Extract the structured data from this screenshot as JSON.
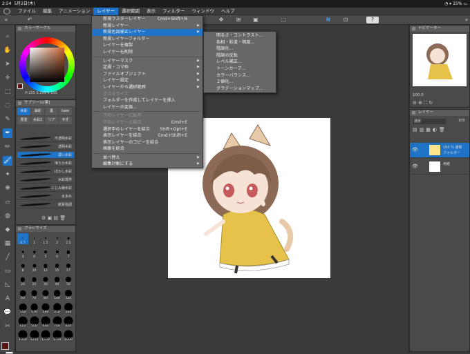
{
  "status": {
    "time": "2:54",
    "date": "5月2日(木)",
    "battery": "15%"
  },
  "menubar": [
    "ファイル",
    "編集",
    "アニメーション",
    "レイヤー",
    "選択範囲",
    "表示",
    "フィルター",
    "ウィンドウ",
    "ヘルプ"
  ],
  "panels": {
    "color": "カラーサークル",
    "hsv": "H 255  S 255  V 255",
    "subtool": "サブツール[筆]",
    "brushsize": "ブラシサイズ",
    "navigator": "ナビゲーター",
    "layer": "レイヤー",
    "nav_zoom": "100.0",
    "blend": "通常",
    "opacity": "100"
  },
  "subtool_tabs": [
    "水彩",
    "油彩",
    "墨",
    "taxe",
    "厚塗",
    "水彩2",
    "リア",
    "ネオ"
  ],
  "brushes": [
    "不透明水彩",
    "透明水彩",
    "濃い水彩",
    "滑らか水彩",
    "ぼかし水彩",
    "水彩境界",
    "にじみ縁水彩",
    "水多め",
    "紙質強調"
  ],
  "brush_sizes": [
    "0.7",
    "1",
    "1.5",
    "2",
    "2.5",
    "3",
    "4",
    "5",
    "6",
    "7",
    "8",
    "10",
    "12",
    "15",
    "17",
    "20",
    "25",
    "30",
    "40",
    "50",
    "60",
    "70",
    "80",
    "100",
    "120",
    "150",
    "170",
    "200",
    "250",
    "300",
    "400",
    "500",
    "600",
    "700",
    "800",
    "1000",
    "1200",
    "1500",
    "1700",
    "2000"
  ],
  "layers": [
    {
      "name": "100 % 通常",
      "sub": "フォルダー"
    },
    {
      "name": "用紙",
      "sub": ""
    }
  ],
  "layer_menu": [
    {
      "label": "新規ラスターレイヤー",
      "shortcut": "Cmd+Shift+N",
      "arrow": false,
      "state": "normal"
    },
    {
      "label": "新規レイヤー",
      "shortcut": "",
      "arrow": true,
      "state": "normal"
    },
    {
      "label": "新規色調補正レイヤー",
      "shortcut": "",
      "arrow": true,
      "state": "highlight"
    },
    {
      "label": "新規レイヤーフォルダー",
      "shortcut": "",
      "arrow": false,
      "state": "normal"
    },
    {
      "label": "レイヤーを複製",
      "shortcut": "",
      "arrow": false,
      "state": "normal"
    },
    {
      "label": "レイヤーを削除",
      "shortcut": "",
      "arrow": false,
      "state": "normal"
    },
    {
      "sep": true
    },
    {
      "label": "レイヤーマスク",
      "shortcut": "",
      "arrow": true,
      "state": "normal"
    },
    {
      "label": "定規・コマ枠",
      "shortcut": "",
      "arrow": true,
      "state": "normal"
    },
    {
      "label": "ファイルオブジェクト",
      "shortcut": "",
      "arrow": true,
      "state": "normal"
    },
    {
      "label": "レイヤー設定",
      "shortcut": "",
      "arrow": true,
      "state": "normal"
    },
    {
      "label": "レイヤーから選択範囲",
      "shortcut": "",
      "arrow": true,
      "state": "normal"
    },
    {
      "label": "ラスタライズ",
      "shortcut": "",
      "arrow": false,
      "state": "disabled"
    },
    {
      "label": "フォルダーを作成してレイヤーを挿入",
      "shortcut": "",
      "arrow": false,
      "state": "normal"
    },
    {
      "label": "レイヤーの変換...",
      "shortcut": "",
      "arrow": false,
      "state": "normal"
    },
    {
      "sep": true
    },
    {
      "label": "下のレイヤーに転写",
      "shortcut": "",
      "arrow": false,
      "state": "disabled"
    },
    {
      "label": "下のレイヤーと結合",
      "shortcut": "Cmd+E",
      "arrow": false,
      "state": "disabled"
    },
    {
      "label": "選択中のレイヤーを結合",
      "shortcut": "Shift+Opt+E",
      "arrow": false,
      "state": "normal"
    },
    {
      "label": "表示レイヤーを結合",
      "shortcut": "Cmd+Shift+E",
      "arrow": false,
      "state": "normal"
    },
    {
      "label": "表示レイヤーのコピーを結合",
      "shortcut": "",
      "arrow": false,
      "state": "normal"
    },
    {
      "label": "画像を統合",
      "shortcut": "",
      "arrow": false,
      "state": "normal"
    },
    {
      "sep": true
    },
    {
      "label": "並べ替え",
      "shortcut": "",
      "arrow": true,
      "state": "normal"
    },
    {
      "label": "編集対象にする",
      "shortcut": "",
      "arrow": true,
      "state": "normal"
    }
  ],
  "sub_menu": [
    "明るさ・コントラスト...",
    "色相・彩度・明度...",
    "階調化...",
    "階調の反転",
    "レベル補正...",
    "トーンカーブ...",
    "カラーバランス...",
    "２値化...",
    "グラデーションマップ..."
  ],
  "colors": {
    "accent": "#1f74c7",
    "menu_bg": "#676767",
    "panel": "#4a4a4a"
  }
}
